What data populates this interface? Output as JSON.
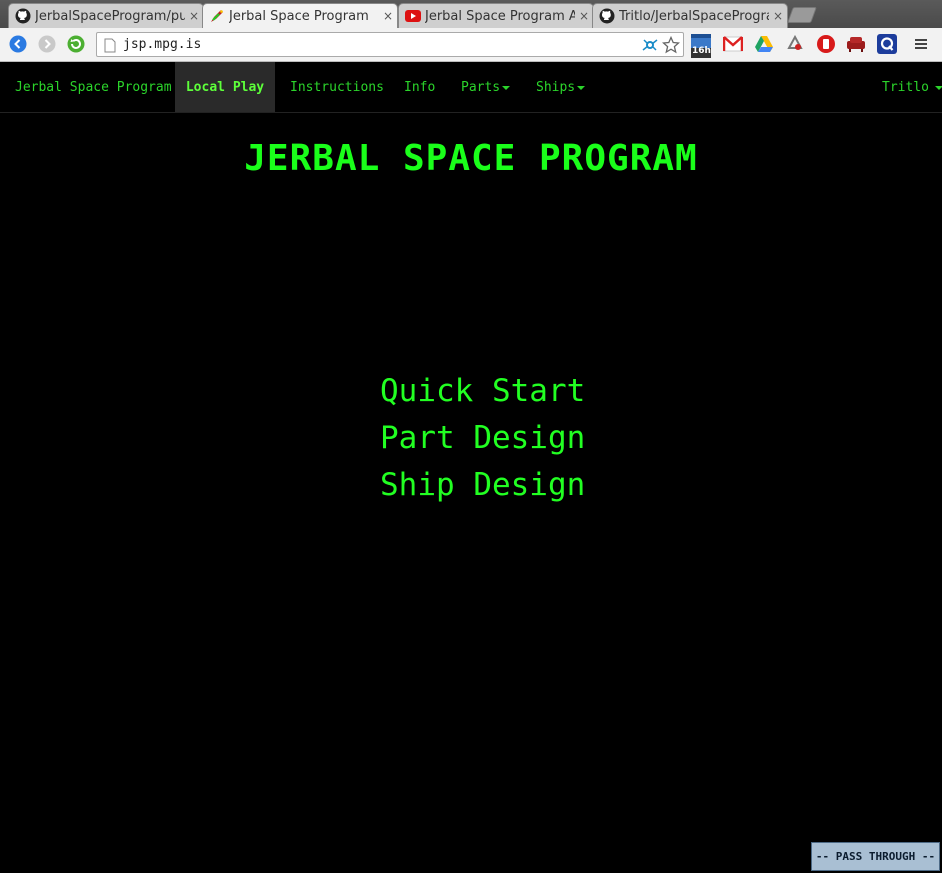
{
  "browser": {
    "tabs": [
      {
        "title": "JerbalSpaceProgram/pu",
        "icon": "github-icon"
      },
      {
        "title": "Jerbal Space Program",
        "icon": "rocket-icon",
        "active": true
      },
      {
        "title": "Jerbal Space Program A",
        "icon": "youtube-icon"
      },
      {
        "title": "Tritlo/JerbalSpaceProgra",
        "icon": "github-icon"
      }
    ],
    "close_glyph": "×",
    "url": "jsp.mpg.is",
    "extension_badge": "16h"
  },
  "site": {
    "brand": "Jerbal Space Program",
    "nav": {
      "local_play": "Local Play",
      "instructions": "Instructions",
      "info": "Info",
      "parts": "Parts",
      "ships": "Ships",
      "user": "Tritlo"
    },
    "title": "JERBAL SPACE PROGRAM",
    "menu": [
      "Quick Start",
      "Part Design",
      "Ship Design"
    ],
    "pass_through": "-- PASS THROUGH --"
  },
  "colors": {
    "terminal_green": "#22ff22",
    "nav_green": "#2bd42b",
    "background": "#000000"
  }
}
